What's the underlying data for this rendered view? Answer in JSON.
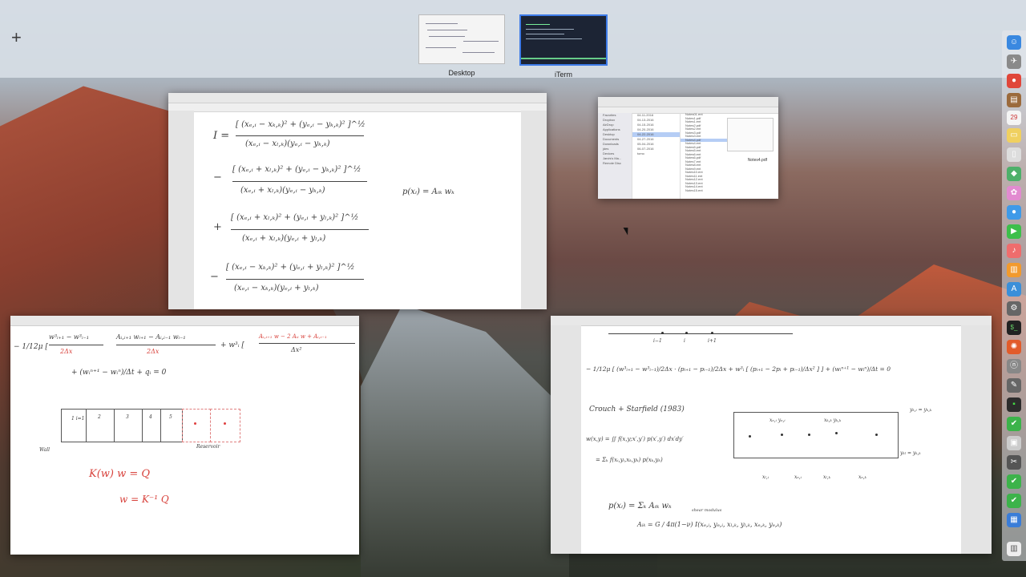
{
  "mission_control": {
    "add_space": "+",
    "spaces": [
      {
        "label": "Desktop"
      },
      {
        "label": "iTerm"
      }
    ]
  },
  "finder": {
    "sidebar": [
      "Favorites",
      "Dropbox",
      "AirDrop",
      "Applications",
      "Desktop",
      "Documents",
      "Downloads",
      "jdes",
      "Devices",
      "Jarvis's Ma...",
      "Remote Disc"
    ],
    "folders": [
      "04-11-2016",
      "04-13-2016",
      "04-15-2016",
      "04-20-2016",
      "04-22-2016",
      "04-27-2016",
      "05-04-2016",
      "06-07-2016",
      "tomo"
    ],
    "files": [
      "Notes01.ent",
      "Notes1.pdf",
      "Notes1.ent",
      "Notes2.pdf",
      "Notes2.ent",
      "Notes3.pdf",
      "Notes3.ent",
      "Notes4.pdf",
      "Notes4.ent",
      "Notes5.pdf",
      "Notes5.ent",
      "Notes6.ent",
      "Notes6.pdf",
      "Notes7.ent",
      "Notes8.ent",
      "Notes9.ent",
      "Notes10.ent",
      "Notes11.ent",
      "Notes12.ent",
      "Notes13.ent",
      "Notes14.ent",
      "Notes15.ent"
    ],
    "preview_name": "Notes4.pdf"
  },
  "note_top": {
    "lines": [
      {
        "sign": "I =",
        "num": "[ (xₑ,ᵢ − xₖ,ₖ)² + (yₑ,ᵢ − yₖ,ₖ)² ]^½",
        "den": "(xₑ,ᵢ − xₗ,ₖ)(yₑ,ᵢ − yₖ,ₖ)"
      },
      {
        "sign": "−",
        "num": "[ (xₑ,ᵢ + xₗ,ₖ)² + (yₑ,ᵢ − yₖ,ₖ)² ]^½",
        "den": "(xₑ,ᵢ + xₗ,ₖ)(yₑ,ᵢ − yₖ,ₖ)"
      },
      {
        "sign": "+",
        "num": "[ (xₑ,ᵢ + xₗ,ₖ)² + (yₑ,ᵢ + yₗ,ₖ)² ]^½",
        "den": "(xₑ,ᵢ + xₗ,ₖ)(yₑ,ᵢ + yₗ,ₖ)"
      },
      {
        "sign": "−",
        "num": "[ (xₑ,ᵢ − xₖ,ₖ)² + (yₑ,ᵢ + yₗ,ₖ)² ]^½",
        "den": "(xₑ,ᵢ − xₖ,ₖ)(yₑ,ᵢ + yₗ,ₖ)"
      }
    ],
    "side_eq": "p(xᵢ) =   Aᵢₖ wₖ"
  },
  "note_left": {
    "eq1_prefix": "− 1/12μ [",
    "eq1_a_num": "w³ᵢ₊₁ − w³ᵢ₋₁",
    "eq1_a_den": "2Δx",
    "eq1_b_num": "Aᵢ,ᵢ₊₁ wᵢ₊₁ − Aᵢ,ᵢ₋₁ wᵢ₋₁",
    "eq1_b_den": "2Δx",
    "eq1_c": "+ w³ᵢ [",
    "eq1_c_num": "Aᵢ,ᵢ₊₁ w − 2 Aᵢᵢ w + Aᵢ,ᵢ₋₁",
    "eq1_c_den": "Δx²",
    "eq2": "+ (wᵢⁿ⁺¹ − wᵢⁿ)/Δt + qᵢ = 0",
    "cells": [
      "1\ni=1",
      "2",
      "3",
      "4",
      "5"
    ],
    "wall": "Wall",
    "reservoir": "Reservoir",
    "matrix1": "K(w) w = Q",
    "matrix2": "w = K⁻¹ Q"
  },
  "note_right": {
    "grid_labels": [
      "i−1",
      "i",
      "i+1"
    ],
    "eq1": "− 1/12μ [ (w³ᵢ₊₁ − w³ᵢ₋₁)/2Δx · (pᵢ₊₁ − pᵢ₋₁)/2Δx + w³ᵢ [ (pᵢ₊₁ − 2pᵢ + pᵢ₋₁)/Δx² ] ] + (wᵢⁿ⁺¹ − wᵢⁿ)/Δt = 0",
    "citation": "Crouch + Starfield (1983)",
    "integral": "w(x,y) = ∬ f(x,y;x′,y′) p(x′,y′) dx′dy′",
    "sum": "= Σₖ f(xᵢ,yᵢ,xₖ,yₖ) p(xₖ,yₖ)",
    "box_top": "yₖ,ᵢ = yₖ,ₖ",
    "box_bottom": "yₖₗ = yₖ,ₖ",
    "box_inner1": "xₑ,ᵢ yₑ,ᵢ",
    "box_inner2": "xₖ,ₖ yₖ,ₖ",
    "axis_labels": [
      "xₗ,ᵢ",
      "xₑ,ᵢ",
      "xₗ,ₖ",
      "xₑ,ₖ"
    ],
    "pxi": "p(xᵢ) = Σₖ Aᵢₖ wₖ",
    "shear_note": "shear modulus",
    "aik": "Aᵢₖ = G / 4π(1−ν)  I(xₑ,ᵢ, yₑ,ᵢ, xₗ,ₖ, yₗ,ₖ, xₑ,ₖ, yₑ,ₖ)"
  }
}
